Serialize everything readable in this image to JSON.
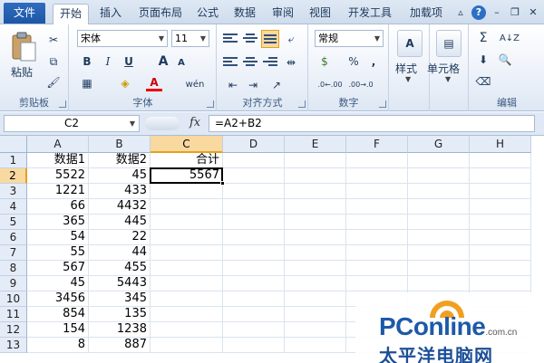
{
  "tabs": {
    "file": "文件",
    "items": [
      "开始",
      "插入",
      "页面布局",
      "公式",
      "数据",
      "审阅",
      "视图",
      "开发工具",
      "加载项"
    ],
    "active_index": 0
  },
  "ribbon": {
    "clipboard": {
      "label": "剪贴板",
      "paste": "粘贴"
    },
    "font": {
      "label": "字体",
      "name": "宋体",
      "size": "11",
      "bold": "B",
      "italic": "I",
      "underline": "U",
      "grow": "A",
      "shrink": "A",
      "wen": "wén"
    },
    "align": {
      "label": "对齐方式"
    },
    "number": {
      "label": "数字",
      "format": "常规",
      "percent": "%",
      "comma": ",",
      "inc": ".0←.00",
      "dec": ".00→.0"
    },
    "styles": {
      "label": "",
      "text": "样式"
    },
    "cells": {
      "label": "",
      "text": "单元格"
    },
    "editing": {
      "label": "编辑",
      "sum": "Σ",
      "sort": "A↓Z"
    }
  },
  "formula_bar": {
    "name_box": "C2",
    "fx": "fx",
    "formula": "=A2+B2"
  },
  "sheet": {
    "columns": [
      "A",
      "B",
      "C",
      "D",
      "E",
      "F",
      "G",
      "H"
    ],
    "selected_column": "C",
    "selected_row": 2,
    "row_numbers": [
      1,
      2,
      3,
      4,
      5,
      6,
      7,
      8,
      9,
      10,
      11,
      12,
      13
    ],
    "rows": [
      [
        "数据1",
        "数据2",
        "合计"
      ],
      [
        "5522",
        "45",
        "5567"
      ],
      [
        "1221",
        "433",
        ""
      ],
      [
        "66",
        "4432",
        ""
      ],
      [
        "365",
        "445",
        ""
      ],
      [
        "54",
        "22",
        ""
      ],
      [
        "55",
        "44",
        ""
      ],
      [
        "567",
        "455",
        ""
      ],
      [
        "45",
        "5443",
        ""
      ],
      [
        "3456",
        "345",
        ""
      ],
      [
        "854",
        "135",
        ""
      ],
      [
        "154",
        "1238",
        ""
      ],
      [
        "8",
        "887",
        ""
      ]
    ]
  },
  "watermark": {
    "brand_pc": "PC",
    "brand_rest": "online",
    "domain": ".com.cn",
    "chinese": "太平洋电脑网"
  },
  "colors": {
    "file_tab": "#2366b8",
    "selection_header": "#f9d99f",
    "selection_accent": "#e3a21a",
    "brand_blue": "#1d5aa7",
    "brand_orange": "#f0a020"
  }
}
